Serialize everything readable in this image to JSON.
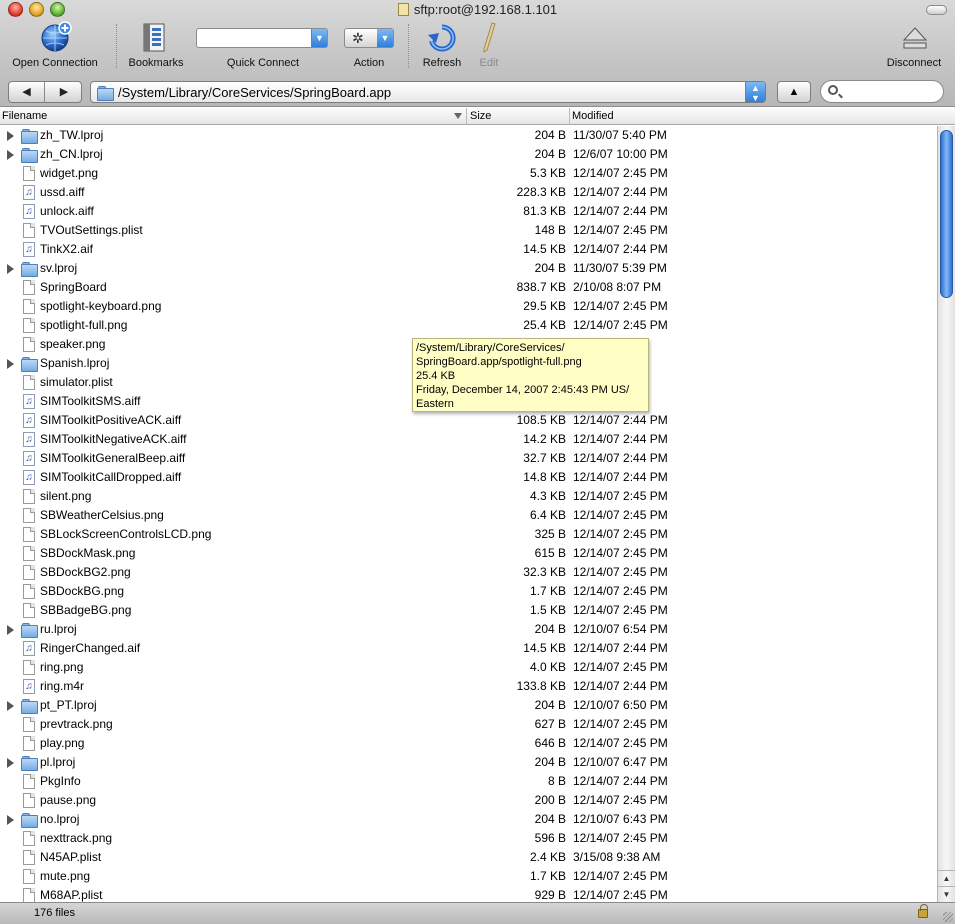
{
  "window": {
    "title": "sftp:root@192.168.1.101"
  },
  "toolbar": {
    "open_connection": "Open Connection",
    "bookmarks": "Bookmarks",
    "quick_connect": "Quick Connect",
    "quick_connect_value": "",
    "action": "Action",
    "refresh": "Refresh",
    "edit": "Edit",
    "disconnect": "Disconnect"
  },
  "pathbar": {
    "path": "/System/Library/CoreServices/SpringBoard.app",
    "search_value": ""
  },
  "columns": {
    "filename": "Filename",
    "size": "Size",
    "modified": "Modified"
  },
  "files": [
    {
      "name": "zh_TW.lproj",
      "size": "204 B",
      "modified": "11/30/07 5:40 PM",
      "type": "folder"
    },
    {
      "name": "zh_CN.lproj",
      "size": "204 B",
      "modified": "12/6/07 10:00 PM",
      "type": "folder"
    },
    {
      "name": "widget.png",
      "size": "5.3 KB",
      "modified": "12/14/07 2:45 PM",
      "type": "doc"
    },
    {
      "name": "ussd.aiff",
      "size": "228.3 KB",
      "modified": "12/14/07 2:44 PM",
      "type": "audio"
    },
    {
      "name": "unlock.aiff",
      "size": "81.3 KB",
      "modified": "12/14/07 2:44 PM",
      "type": "audio"
    },
    {
      "name": "TVOutSettings.plist",
      "size": "148 B",
      "modified": "12/14/07 2:45 PM",
      "type": "doc"
    },
    {
      "name": "TinkX2.aif",
      "size": "14.5 KB",
      "modified": "12/14/07 2:44 PM",
      "type": "audio"
    },
    {
      "name": "sv.lproj",
      "size": "204 B",
      "modified": "11/30/07 5:39 PM",
      "type": "folder"
    },
    {
      "name": "SpringBoard",
      "size": "838.7 KB",
      "modified": "2/10/08 8:07 PM",
      "type": "doc"
    },
    {
      "name": "spotlight-keyboard.png",
      "size": "29.5 KB",
      "modified": "12/14/07 2:45 PM",
      "type": "doc"
    },
    {
      "name": "spotlight-full.png",
      "size": "25.4 KB",
      "modified": "12/14/07 2:45 PM",
      "type": "doc"
    },
    {
      "name": "speaker.png",
      "size": "",
      "modified": "",
      "type": "doc"
    },
    {
      "name": "Spanish.lproj",
      "size": "",
      "modified": "",
      "type": "folder"
    },
    {
      "name": "simulator.plist",
      "size": "",
      "modified": "",
      "type": "doc"
    },
    {
      "name": "SIMToolkitSMS.aiff",
      "size": "",
      "modified": "",
      "type": "audio"
    },
    {
      "name": "SIMToolkitPositiveACK.aiff",
      "size": "108.5 KB",
      "modified": "12/14/07 2:44 PM",
      "type": "audio"
    },
    {
      "name": "SIMToolkitNegativeACK.aiff",
      "size": "14.2 KB",
      "modified": "12/14/07 2:44 PM",
      "type": "audio"
    },
    {
      "name": "SIMToolkitGeneralBeep.aiff",
      "size": "32.7 KB",
      "modified": "12/14/07 2:44 PM",
      "type": "audio"
    },
    {
      "name": "SIMToolkitCallDropped.aiff",
      "size": "14.8 KB",
      "modified": "12/14/07 2:44 PM",
      "type": "audio"
    },
    {
      "name": "silent.png",
      "size": "4.3 KB",
      "modified": "12/14/07 2:45 PM",
      "type": "doc"
    },
    {
      "name": "SBWeatherCelsius.png",
      "size": "6.4 KB",
      "modified": "12/14/07 2:45 PM",
      "type": "doc"
    },
    {
      "name": "SBLockScreenControlsLCD.png",
      "size": "325 B",
      "modified": "12/14/07 2:45 PM",
      "type": "doc"
    },
    {
      "name": "SBDockMask.png",
      "size": "615 B",
      "modified": "12/14/07 2:45 PM",
      "type": "doc"
    },
    {
      "name": "SBDockBG2.png",
      "size": "32.3 KB",
      "modified": "12/14/07 2:45 PM",
      "type": "doc"
    },
    {
      "name": "SBDockBG.png",
      "size": "1.7 KB",
      "modified": "12/14/07 2:45 PM",
      "type": "doc"
    },
    {
      "name": "SBBadgeBG.png",
      "size": "1.5 KB",
      "modified": "12/14/07 2:45 PM",
      "type": "doc"
    },
    {
      "name": "ru.lproj",
      "size": "204 B",
      "modified": "12/10/07 6:54 PM",
      "type": "folder"
    },
    {
      "name": "RingerChanged.aif",
      "size": "14.5 KB",
      "modified": "12/14/07 2:44 PM",
      "type": "audio"
    },
    {
      "name": "ring.png",
      "size": "4.0 KB",
      "modified": "12/14/07 2:45 PM",
      "type": "doc"
    },
    {
      "name": "ring.m4r",
      "size": "133.8 KB",
      "modified": "12/14/07 2:44 PM",
      "type": "audio"
    },
    {
      "name": "pt_PT.lproj",
      "size": "204 B",
      "modified": "12/10/07 6:50 PM",
      "type": "folder"
    },
    {
      "name": "prevtrack.png",
      "size": "627 B",
      "modified": "12/14/07 2:45 PM",
      "type": "doc"
    },
    {
      "name": "play.png",
      "size": "646 B",
      "modified": "12/14/07 2:45 PM",
      "type": "doc"
    },
    {
      "name": "pl.lproj",
      "size": "204 B",
      "modified": "12/10/07 6:47 PM",
      "type": "folder"
    },
    {
      "name": "PkgInfo",
      "size": "8 B",
      "modified": "12/14/07 2:44 PM",
      "type": "doc"
    },
    {
      "name": "pause.png",
      "size": "200 B",
      "modified": "12/14/07 2:45 PM",
      "type": "doc"
    },
    {
      "name": "no.lproj",
      "size": "204 B",
      "modified": "12/10/07 6:43 PM",
      "type": "folder"
    },
    {
      "name": "nexttrack.png",
      "size": "596 B",
      "modified": "12/14/07 2:45 PM",
      "type": "doc"
    },
    {
      "name": "N45AP.plist",
      "size": "2.4 KB",
      "modified": "3/15/08 9:38 AM",
      "type": "doc"
    },
    {
      "name": "mute.png",
      "size": "1.7 KB",
      "modified": "12/14/07 2:45 PM",
      "type": "doc"
    },
    {
      "name": "M68AP.plist",
      "size": "929 B",
      "modified": "12/14/07 2:45 PM",
      "type": "doc"
    }
  ],
  "tooltip": {
    "line1": "/System/Library/CoreServices/",
    "line2": "SpringBoard.app/spotlight-full.png",
    "line3": "25.4 KB",
    "line4": "Friday, December 14, 2007 2:45:43 PM US/",
    "line5": "Eastern"
  },
  "status": {
    "text": "176 files"
  }
}
